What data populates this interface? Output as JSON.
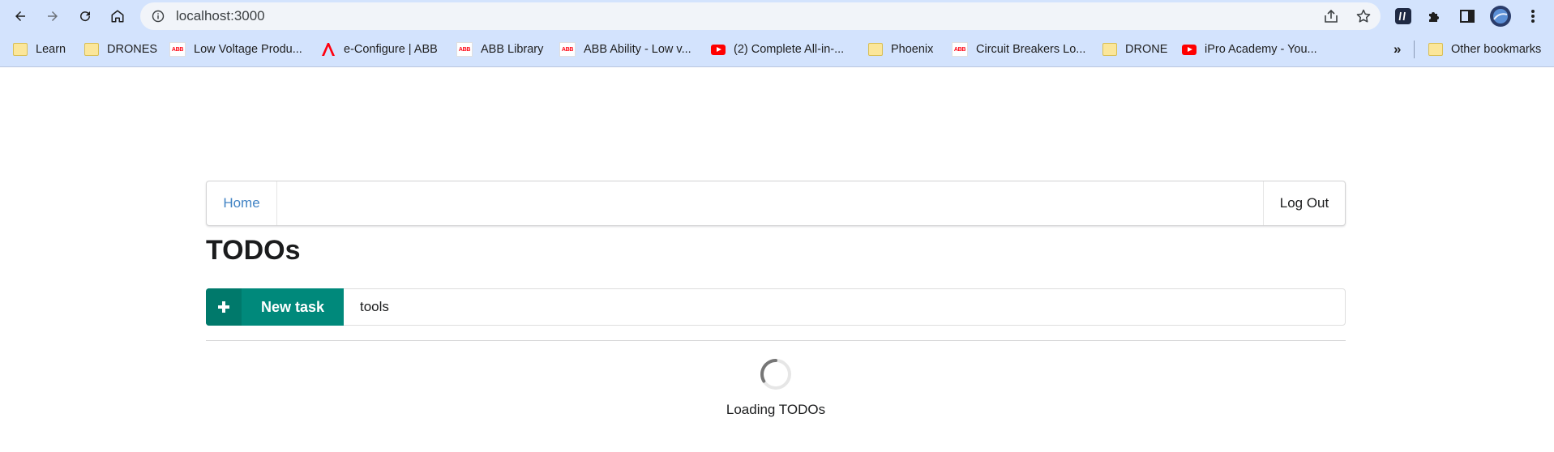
{
  "browser": {
    "url": "localhost:3000",
    "bookmarks": [
      {
        "label": "Learn",
        "icon": "folder-icon"
      },
      {
        "label": "DRONES",
        "icon": "folder-icon"
      },
      {
        "label": "Low Voltage Produ...",
        "icon": "abb-icon"
      },
      {
        "label": "e-Configure | ABB",
        "icon": "abb-a-icon"
      },
      {
        "label": "ABB Library",
        "icon": "abb-icon"
      },
      {
        "label": "ABB Ability - Low v...",
        "icon": "abb-icon"
      },
      {
        "label": "(2) Complete All-in-...",
        "icon": "youtube-icon"
      },
      {
        "label": "Phoenix",
        "icon": "folder-icon"
      },
      {
        "label": "Circuit Breakers Lo...",
        "icon": "abb-icon"
      },
      {
        "label": "DRONE",
        "icon": "folder-icon"
      },
      {
        "label": "iPro Academy - You...",
        "icon": "youtube-icon"
      }
    ],
    "more_bookmarks": "»",
    "other_bookmarks": "Other bookmarks",
    "abb_logo_text": "ABB"
  },
  "nav": {
    "home": "Home",
    "logout": "Log Out"
  },
  "page": {
    "title": "TODOs",
    "new_task_label": "New task",
    "task_input_value": "tools",
    "loading_text": "Loading TODOs"
  },
  "colors": {
    "toolbar_bg": "#d3e3fd",
    "accent": "#00897b",
    "accent_dark": "#00796b",
    "link": "#4183c4"
  }
}
